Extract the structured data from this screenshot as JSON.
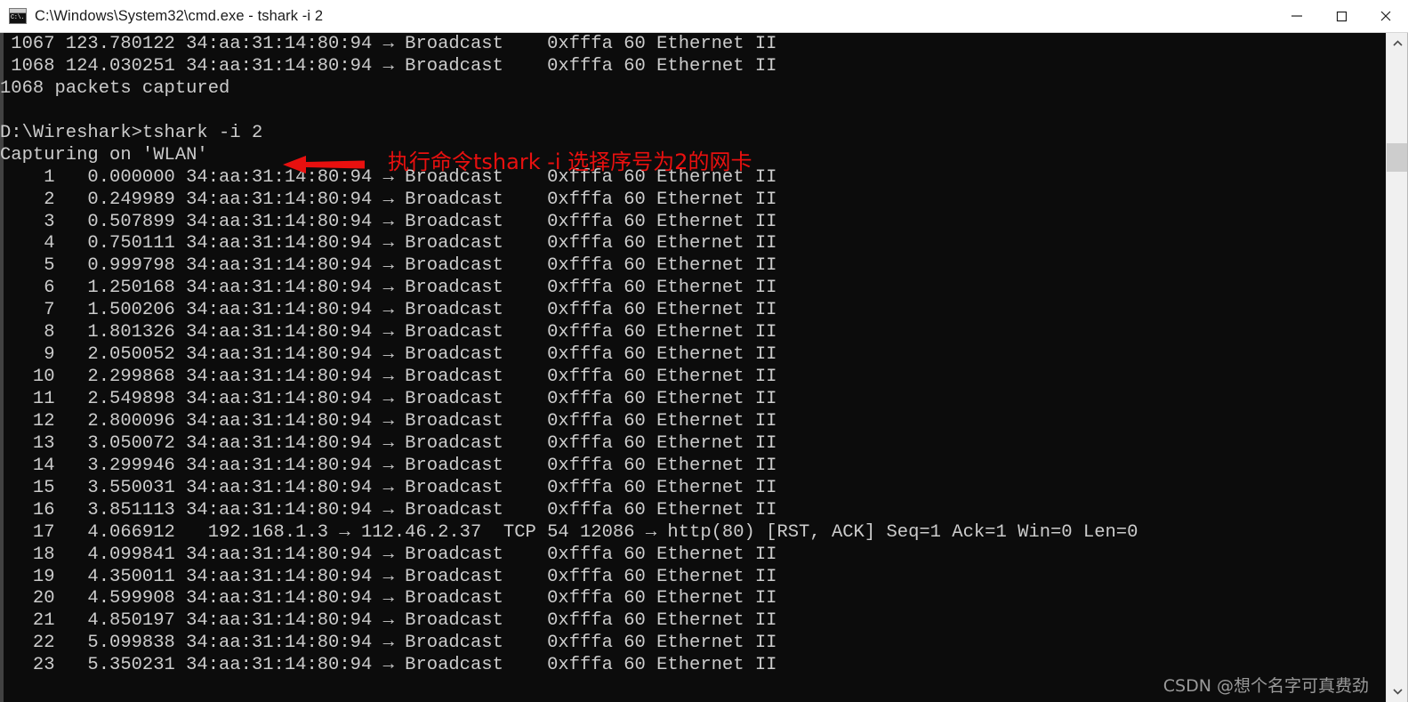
{
  "window": {
    "title": "C:\\Windows\\System32\\cmd.exe - tshark  -i 2",
    "icon_name": "cmd-console-icon",
    "icon_glyph": "C:\\.",
    "background_color": "#0c0c0c",
    "text_color": "#cccccc",
    "titlebar_background": "#ffffff",
    "controls": {
      "minimize_label": "Minimize",
      "maximize_label": "Maximize",
      "close_label": "Close"
    }
  },
  "console": {
    "lines": [
      " 1067 123.780122 34:aa:31:14:80:94 → Broadcast    0xfffa 60 Ethernet II",
      " 1068 124.030251 34:aa:31:14:80:94 → Broadcast    0xfffa 60 Ethernet II",
      "1068 packets captured",
      "",
      "D:\\Wireshark>tshark -i 2",
      "Capturing on 'WLAN'",
      "    1   0.000000 34:aa:31:14:80:94 → Broadcast    0xfffa 60 Ethernet II",
      "    2   0.249989 34:aa:31:14:80:94 → Broadcast    0xfffa 60 Ethernet II",
      "    3   0.507899 34:aa:31:14:80:94 → Broadcast    0xfffa 60 Ethernet II",
      "    4   0.750111 34:aa:31:14:80:94 → Broadcast    0xfffa 60 Ethernet II",
      "    5   0.999798 34:aa:31:14:80:94 → Broadcast    0xfffa 60 Ethernet II",
      "    6   1.250168 34:aa:31:14:80:94 → Broadcast    0xfffa 60 Ethernet II",
      "    7   1.500206 34:aa:31:14:80:94 → Broadcast    0xfffa 60 Ethernet II",
      "    8   1.801326 34:aa:31:14:80:94 → Broadcast    0xfffa 60 Ethernet II",
      "    9   2.050052 34:aa:31:14:80:94 → Broadcast    0xfffa 60 Ethernet II",
      "   10   2.299868 34:aa:31:14:80:94 → Broadcast    0xfffa 60 Ethernet II",
      "   11   2.549898 34:aa:31:14:80:94 → Broadcast    0xfffa 60 Ethernet II",
      "   12   2.800096 34:aa:31:14:80:94 → Broadcast    0xfffa 60 Ethernet II",
      "   13   3.050072 34:aa:31:14:80:94 → Broadcast    0xfffa 60 Ethernet II",
      "   14   3.299946 34:aa:31:14:80:94 → Broadcast    0xfffa 60 Ethernet II",
      "   15   3.550031 34:aa:31:14:80:94 → Broadcast    0xfffa 60 Ethernet II",
      "   16   3.851113 34:aa:31:14:80:94 → Broadcast    0xfffa 60 Ethernet II",
      "   17   4.066912   192.168.1.3 → 112.46.2.37  TCP 54 12086 → http(80) [RST, ACK] Seq=1 Ack=1 Win=0 Len=0",
      "   18   4.099841 34:aa:31:14:80:94 → Broadcast    0xfffa 60 Ethernet II",
      "   19   4.350011 34:aa:31:14:80:94 → Broadcast    0xfffa 60 Ethernet II",
      "   20   4.599908 34:aa:31:14:80:94 → Broadcast    0xfffa 60 Ethernet II",
      "   21   4.850197 34:aa:31:14:80:94 → Broadcast    0xfffa 60 Ethernet II",
      "   22   5.099838 34:aa:31:14:80:94 → Broadcast    0xfffa 60 Ethernet II",
      "   23   5.350231 34:aa:31:14:80:94 → Broadcast    0xfffa 60 Ethernet II"
    ],
    "prompt": "D:\\Wireshark>",
    "command": "tshark -i 2",
    "capture_status": "Capturing on 'WLAN'",
    "packets_captured": "1068 packets captured"
  },
  "annotation": {
    "text": "执行命令tshark -i 选择序号为2的网卡",
    "color": "#e8100f",
    "arrow_direction": "left"
  },
  "watermark": {
    "text": "CSDN @想个名字可真费劲"
  },
  "scrollbar": {
    "up_arrow": "⌃",
    "down_arrow": "⌄",
    "thumb_position": "near-top"
  }
}
